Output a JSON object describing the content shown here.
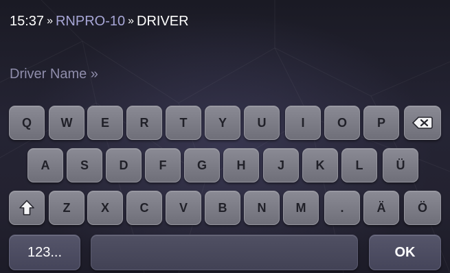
{
  "header": {
    "time": "15:37",
    "separator": "»",
    "breadcrumb": "RNPRO-10",
    "current": "DRIVER"
  },
  "input": {
    "label": "Driver Name »",
    "value": ""
  },
  "keyboard": {
    "row1": [
      "Q",
      "W",
      "E",
      "R",
      "T",
      "Y",
      "U",
      "I",
      "O",
      "P"
    ],
    "row2": [
      "A",
      "S",
      "D",
      "F",
      "G",
      "H",
      "J",
      "K",
      "L",
      "Ü"
    ],
    "row3": [
      "Z",
      "X",
      "C",
      "V",
      "B",
      "N",
      "M",
      ".",
      "Ä",
      "Ö"
    ],
    "backspace_icon": "backspace-icon",
    "shift_icon": "shift-icon",
    "numbers_label": "123...",
    "ok_label": "OK"
  },
  "colors": {
    "background": "#232230",
    "breadcrumb": "#a7a6d6",
    "label": "#8f8dab",
    "key": "#7d7d87",
    "key_dark": "#4d4d61"
  }
}
